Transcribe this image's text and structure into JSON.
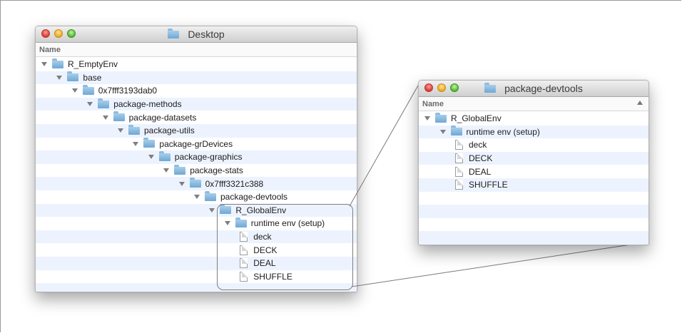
{
  "left_window": {
    "title": "Desktop",
    "column_header": "Name",
    "rows": [
      {
        "label": "R_EmptyEnv",
        "type": "folder",
        "indent": 0
      },
      {
        "label": "base",
        "type": "folder",
        "indent": 1
      },
      {
        "label": "0x7fff3193dab0",
        "type": "folder",
        "indent": 2
      },
      {
        "label": "package-methods",
        "type": "folder",
        "indent": 3
      },
      {
        "label": "package-datasets",
        "type": "folder",
        "indent": 4
      },
      {
        "label": "package-utils",
        "type": "folder",
        "indent": 5
      },
      {
        "label": "package-grDevices",
        "type": "folder",
        "indent": 6
      },
      {
        "label": "package-graphics",
        "type": "folder",
        "indent": 7
      },
      {
        "label": "package-stats",
        "type": "folder",
        "indent": 8
      },
      {
        "label": "0x7fff3321c388",
        "type": "folder",
        "indent": 9
      },
      {
        "label": "package-devtools",
        "type": "folder",
        "indent": 10
      },
      {
        "label": "R_GlobalEnv",
        "type": "folder",
        "indent": 11
      },
      {
        "label": "runtime env (setup)",
        "type": "folder",
        "indent": 12
      },
      {
        "label": "deck",
        "type": "file",
        "indent": 13
      },
      {
        "label": "DECK",
        "type": "file",
        "indent": 13
      },
      {
        "label": "DEAL",
        "type": "file",
        "indent": 13
      },
      {
        "label": "SHUFFLE",
        "type": "file",
        "indent": 13
      },
      {
        "label": "",
        "type": "empty",
        "indent": 0
      }
    ]
  },
  "right_window": {
    "title": "package-devtools",
    "column_header": "Name",
    "rows": [
      {
        "label": "R_GlobalEnv",
        "type": "folder",
        "indent": 0
      },
      {
        "label": "runtime env (setup)",
        "type": "folder",
        "indent": 1
      },
      {
        "label": "deck",
        "type": "file",
        "indent": 2
      },
      {
        "label": "DECK",
        "type": "file",
        "indent": 2
      },
      {
        "label": "DEAL",
        "type": "file",
        "indent": 2
      },
      {
        "label": "SHUFFLE",
        "type": "file",
        "indent": 2
      },
      {
        "label": "",
        "type": "empty",
        "indent": 0
      },
      {
        "label": "",
        "type": "empty",
        "indent": 0
      },
      {
        "label": "",
        "type": "empty",
        "indent": 0
      },
      {
        "label": "",
        "type": "empty",
        "indent": 0
      }
    ]
  },
  "icons": {
    "close": "close-button-icon",
    "minimize": "minimize-button-icon",
    "zoom": "zoom-button-icon",
    "folder": "folder-icon",
    "file": "file-icon",
    "disclosure": "disclosure-triangle-icon",
    "sort": "sort-ascending-icon"
  },
  "colors": {
    "row_stripe": "#edf3fe",
    "folder_blue": "#6ea8d6",
    "close_red": "#e0443e",
    "minimize_yellow": "#f2b22b",
    "zoom_green": "#5fc43a"
  }
}
